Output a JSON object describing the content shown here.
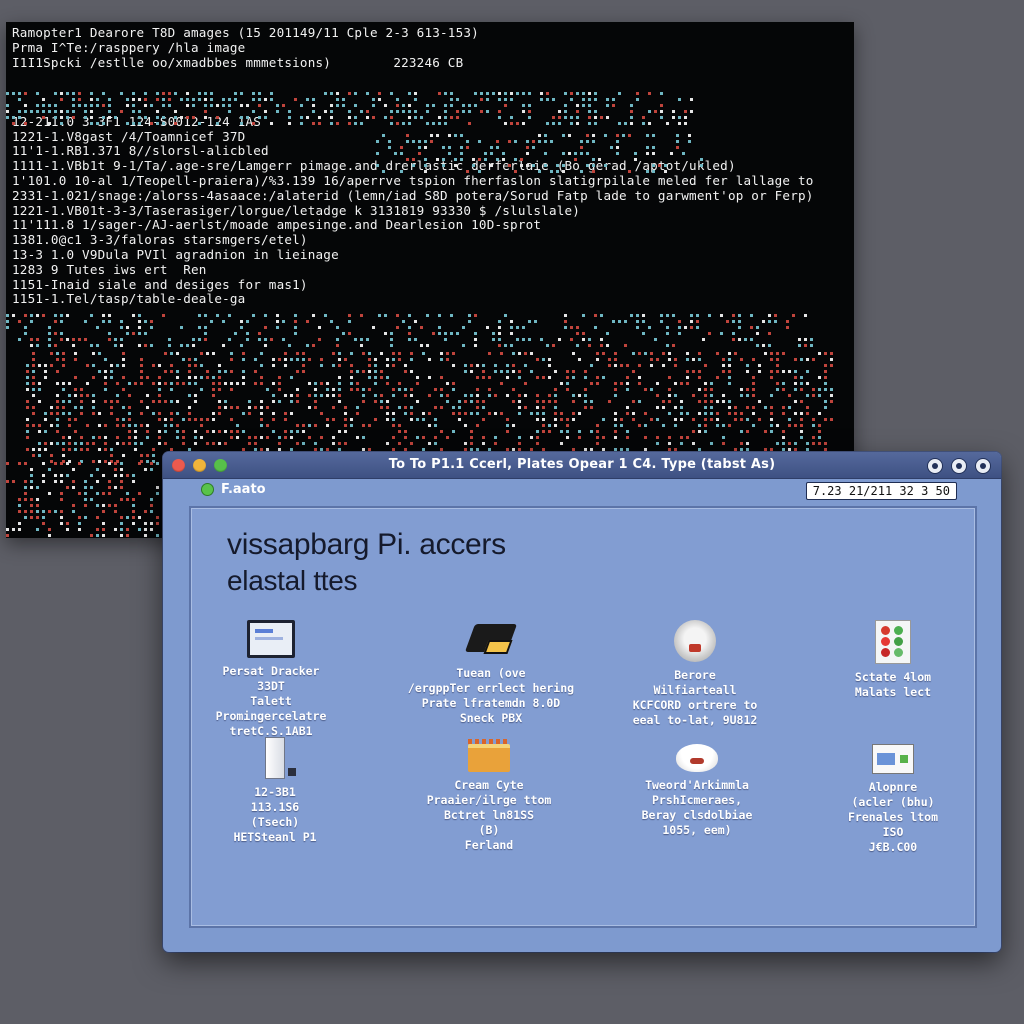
{
  "terminal": {
    "lines": [
      "Ramopter1 Dearore T8D amages (15 201149/11 Cple 2-3 613-153)",
      "Prma I^Te:/rasppery /hla image",
      "I1I1Spcki /estlle oo/xmadbbes mmmetsions)        223246 CB",
      "",
      "",
      "",
      "12-211.0 3 3F1 124-S0012-124 1AS",
      "1221-1.V8gast /4/Toamnicef 37D",
      "11'1-1.RB1.371 8//slorsl-alicbled",
      "1111-1.VBb1t 9-1/Ta/.age-sre/Lamgerr pimage.and drerlastic derferlaie (Bo gerad /aptot/ukled)",
      "1'101.0 10-al 1/Teopell-praiera)/%3.139 16/aperrve tspion fherfaslon slatigrpilale meled fer lallage to",
      "2331-1.021/snage:/alorss-4asaace:/alaterid (lemn/iad S8D potera/Sorud Fatp lade to garwment'op or Ferp)",
      "1221-1.VB01t-3-3/Taserasiger/lorgue/letadge k 3131819 93330 $ /slulslale)",
      "11'111.8 1/sager-/AJ-aerlst/moade ampesinge.and Dearlesion 10D-sprot",
      "1381.0@c1 3-3/faloras starsmgers/etel)",
      "13-3 1.0 V9Dula PVIl agradnion in lieinage",
      "1283 9 Tutes iws ert  Ren",
      "1151-Inaid siale and desiges for mas1)",
      "1151-1.Tel/tasp/table-deale-ga"
    ]
  },
  "window": {
    "title": "To To P1.1 Ccerl, Plates Opear 1 C4. Type (tabst As)",
    "status_label": "F.aato",
    "clock": "7.23 21/211 32 3 50",
    "heading_line1": "vissapbarg Pi. accers",
    "heading_line2": "elastal ttes",
    "tiles": [
      {
        "icon": "monitor-icon",
        "lines": [
          "Persat Dracker",
          "33DT",
          "Talett",
          "Promingercelatre",
          "tretC.S.1AB1"
        ]
      },
      {
        "icon": "drive-icon",
        "lines": [
          "Tuean (ove",
          "/ergppTer errlect hering",
          "Prate lfratemdn 8.0D",
          "Sneck PBX"
        ]
      },
      {
        "icon": "fan-icon",
        "lines": [
          "Berore",
          "Wilfiarteall",
          "KCFCORD ortrere to",
          "eeal to-lat, 9U812"
        ]
      },
      {
        "icon": "chip-icon",
        "lines": [
          "Sctate 4lom",
          "Malats lect"
        ]
      },
      {
        "icon": "tower-icon",
        "lines": [
          "12-3B1",
          "113.1S6",
          "(Tsech)",
          "HETSteanl P1"
        ]
      },
      {
        "icon": "cake-icon",
        "lines": [
          "Cream Cyte",
          "Praaier/ilrge ttom",
          "Bctret ln81SS",
          "(B)",
          "Ferland"
        ]
      },
      {
        "icon": "bowl-icon",
        "lines": [
          "Tweord'Arkimmla",
          "PrshIcmeraes,",
          "Beray clsdolbiae",
          "1055, eem)"
        ]
      },
      {
        "icon": "card-icon",
        "lines": [
          "Alopnre",
          "(acler (bhu)",
          "Frenales ltom",
          "ISO",
          "J€B.C00"
        ]
      }
    ]
  },
  "colors": {
    "term_bg": "#050607",
    "term_text": "#f2f2f2",
    "dot_cyan": "#6fb7c3",
    "dot_red": "#c0443c",
    "dot_white": "#e6e6e6",
    "window_bg": "#7e9acf",
    "titlebar": "#3e5183"
  }
}
